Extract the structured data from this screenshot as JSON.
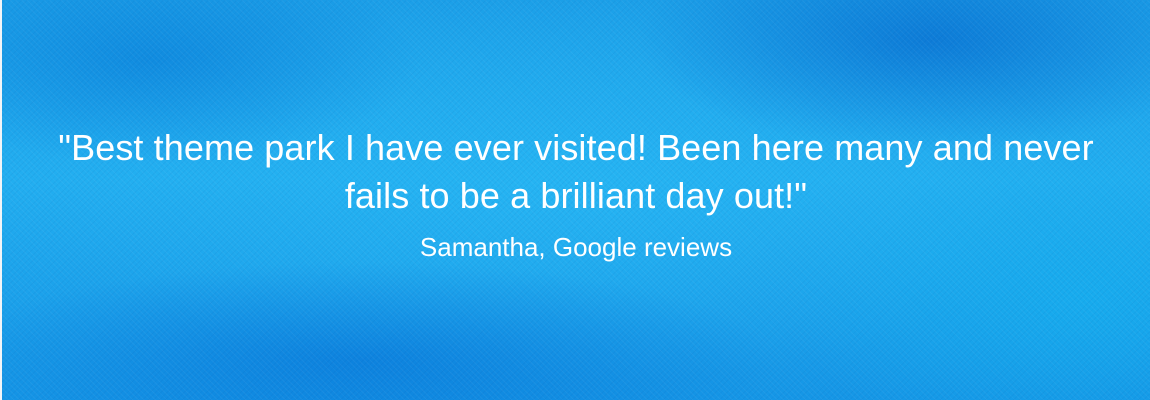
{
  "testimonial": {
    "quote": "\"Best theme park I have ever visited! Been here many and never fails to be a brilliant day out!\"",
    "attribution": "Samantha, Google reviews"
  },
  "colors": {
    "background_primary": "#1b9fe8",
    "background_highlight": "#28b9f5",
    "background_dark": "#005cc8",
    "text": "#ffffff"
  }
}
